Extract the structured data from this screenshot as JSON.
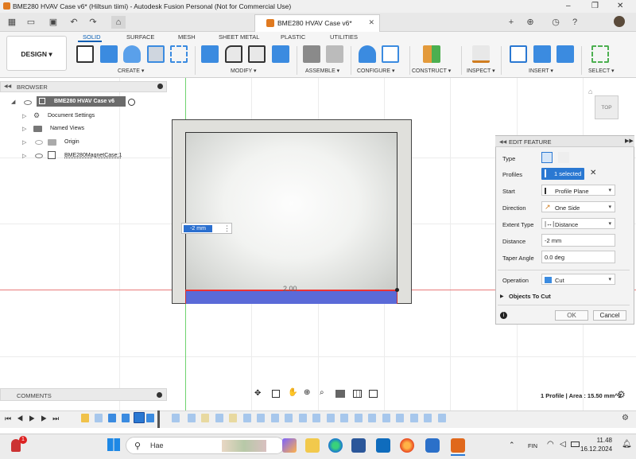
{
  "window": {
    "title": "BME280 HVAV Case v6* (Hiltsun tiimi) - Autodesk Fusion Personal (Not for Commercial Use)",
    "doc_tab": "BME280 HVAV Case v6*",
    "controls": [
      "–",
      "❐",
      "✕"
    ]
  },
  "ribbon": {
    "workspace": "DESIGN ▾",
    "tabs": [
      "SOLID",
      "SURFACE",
      "MESH",
      "SHEET METAL",
      "PLASTIC",
      "UTILITIES"
    ],
    "active_tab": "SOLID",
    "groups": [
      "CREATE ▾",
      "MODIFY ▾",
      "ASSEMBLE ▾",
      "CONFIGURE ▾",
      "CONSTRUCT ▾",
      "INSPECT ▾",
      "INSERT ▾",
      "SELECT ▾"
    ]
  },
  "browser": {
    "title": "BROWSER",
    "root": "BME280 HVAV Case v6",
    "items": [
      "Document Settings",
      "Named Views",
      "Origin",
      "BME280MagnetCase:1"
    ]
  },
  "canvas": {
    "dimension_label": "2.00",
    "dimension_input": "-2 mm",
    "viewcube": "TOP"
  },
  "edit_feature": {
    "title": "EDIT FEATURE",
    "rows": {
      "type": "Type",
      "profiles": "Profiles",
      "profiles_value": "1 selected",
      "start": "Start",
      "start_value": "Profile Plane",
      "direction": "Direction",
      "direction_value": "One Side",
      "extent": "Extent Type",
      "extent_value": "Distance",
      "distance": "Distance",
      "distance_value": "-2 mm",
      "taper": "Taper Angle",
      "taper_value": "0.0 deg",
      "operation": "Operation",
      "operation_value": "Cut",
      "objects": "Objects To Cut"
    },
    "ok": "OK",
    "cancel": "Cancel"
  },
  "comments": "COMMENTS",
  "status": "1 Profile | Area : 15.50 mm^2",
  "taskbar": {
    "search": "Hae",
    "lang": "FIN",
    "time": "11.48",
    "date": "16.12.2024",
    "badge": "1"
  },
  "colors": {
    "accent": "#0a5fb4",
    "profile": "#5a6ad8",
    "selected": "#2a78d2"
  }
}
